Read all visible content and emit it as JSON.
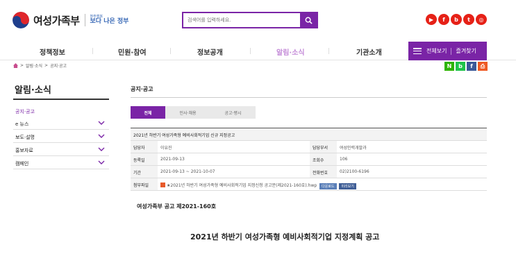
{
  "header": {
    "logo_name": "여성가족부",
    "slogan_small": "청주행복",
    "slogan_big": "보다 나은 정부",
    "search_placeholder": "검색어를 입력하세요.",
    "sns": [
      {
        "icon": "youtube-icon",
        "glyph": "▶",
        "color": "#e62117"
      },
      {
        "icon": "facebook-icon",
        "glyph": "f",
        "color": "#e62117"
      },
      {
        "icon": "blog-icon",
        "glyph": "b",
        "color": "#e62117"
      },
      {
        "icon": "twitter-icon",
        "glyph": "t",
        "color": "#e62117"
      },
      {
        "icon": "instagram-icon",
        "glyph": "◎",
        "color": "#e62117"
      }
    ]
  },
  "gnb": {
    "items": [
      "정책정보",
      "민원·참여",
      "정보공개",
      "알림·소식",
      "기관소개"
    ],
    "active_index": 3,
    "all_menu": "전체보기",
    "favorites": "즐겨찾기"
  },
  "breadcrumb": [
    "알림·소식",
    "공지·공고"
  ],
  "share": [
    {
      "icon": "naver-icon",
      "glyph": "N",
      "color": "#2db400"
    },
    {
      "icon": "band-icon",
      "glyph": "b",
      "color": "#20c44a"
    },
    {
      "icon": "facebook-share-icon",
      "glyph": "f",
      "color": "#3b5998"
    },
    {
      "icon": "print-icon",
      "glyph": "⎙",
      "color": "#ef5a24"
    }
  ],
  "lnb": {
    "title": "알림·소식",
    "items": [
      {
        "label": "공지·공고",
        "active": true,
        "expandable": false
      },
      {
        "label": "e 뉴스",
        "active": false,
        "expandable": true
      },
      {
        "label": "보도·설명",
        "active": false,
        "expandable": true
      },
      {
        "label": "홍보자료",
        "active": false,
        "expandable": true
      },
      {
        "label": "캠페인",
        "active": false,
        "expandable": true
      }
    ]
  },
  "content": {
    "title": "공지·공고",
    "tabs": [
      "전체",
      "인사·채용",
      "공고·평시"
    ],
    "active_tab": 0,
    "subject": "2021년 하반기 여성가족형 예비사회적기업 신규 지정공고",
    "rows": {
      "manager_label": "담당자",
      "manager": "이유진",
      "dept_label": "담당부서",
      "dept": "여성인력개발과",
      "date_label": "등록일",
      "date": "2021-09-13",
      "views_label": "조회수",
      "views": "106",
      "period_label": "기간",
      "period": "2021-09-13 ~ 2021-10-07",
      "phone_label": "전화번호",
      "phone": "02)2100-6196",
      "file_label": "첨부파일",
      "file_name": "★2021년 하반기 여성가족형 예비사회적기업 지정신청 공고문(제2021-160호).hwp",
      "download": "다운로드",
      "preview": "미리보기"
    },
    "doc_number": "여성가족부 공고 제2021-160호",
    "doc_heading": "2021년 하반기 여성가족형 예비사회적기업 지정계획 공고"
  },
  "colors": {
    "accent": "#7a24a6"
  }
}
